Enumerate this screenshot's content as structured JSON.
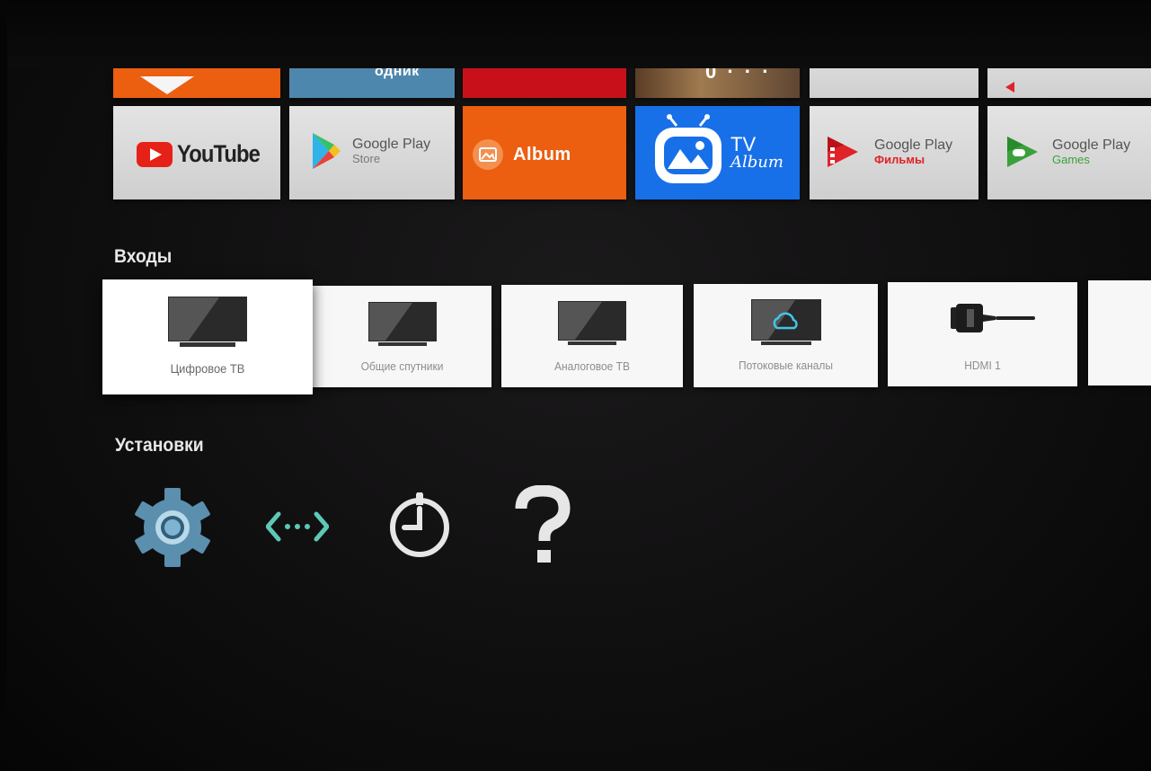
{
  "apps_row_top_partial": [
    {
      "label": "",
      "color": "#ec5e10"
    },
    {
      "label": "одник",
      "color": "#4e87ad"
    },
    {
      "label": "",
      "color": "#c8101b"
    },
    {
      "label": "0 · · ·",
      "color": "#7a5a3a"
    },
    {
      "label": "",
      "color": "#e3e3e3"
    },
    {
      "label": "",
      "color": "#e3e3e3"
    }
  ],
  "apps_row": [
    {
      "name": "youtube",
      "label": "YouTube",
      "color": "#e62117"
    },
    {
      "name": "google-play-store",
      "line1": "Google Play",
      "line2": "Store"
    },
    {
      "name": "album",
      "label": "Album",
      "color": "#ec5e10"
    },
    {
      "name": "tv-album",
      "line1": "TV",
      "line2": "Album",
      "color": "#1870e8"
    },
    {
      "name": "google-play-movies",
      "line1": "Google Play",
      "line2": "Фильмы",
      "accent": "#e02328"
    },
    {
      "name": "google-play-games",
      "line1": "Google Play",
      "line2": "Games",
      "accent": "#3aa13a"
    }
  ],
  "inputs": {
    "title": "Входы",
    "items": [
      {
        "label": "Цифровое ТВ",
        "icon": "tv-icon",
        "focused": true
      },
      {
        "label": "Общие спутники",
        "icon": "tv-icon"
      },
      {
        "label": "Аналоговое ТВ",
        "icon": "tv-icon"
      },
      {
        "label": "Потоковые каналы",
        "icon": "cloud-tv-icon",
        "accent": "#3fc7e8"
      },
      {
        "label": "HDMI 1",
        "icon": "hdmi-icon"
      }
    ]
  },
  "settings": {
    "title": "Установки",
    "items": [
      {
        "icon": "gear-icon",
        "color": "#5a8fae"
      },
      {
        "icon": "network-icon",
        "color": "#5ec8b6"
      },
      {
        "icon": "timer-icon",
        "color": "#e6e6e6"
      },
      {
        "icon": "help-icon",
        "color": "#e6e6e6"
      }
    ]
  }
}
